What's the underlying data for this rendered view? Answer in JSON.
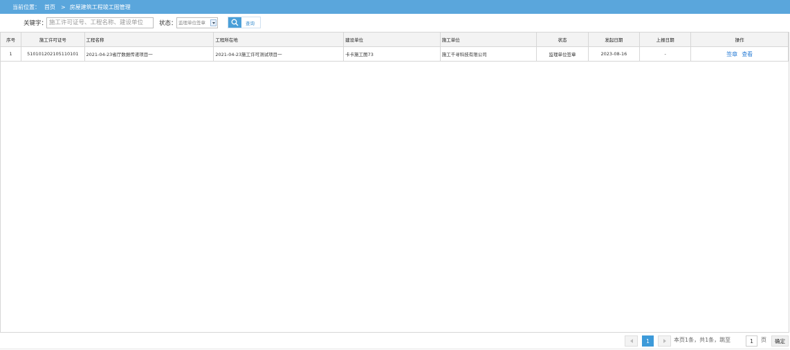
{
  "breadcrumb": {
    "prefix": "当前位置：",
    "home": "首页",
    "separator": ">",
    "current": "房屋建筑工程竣工图管理"
  },
  "filters": {
    "keyword_label": "关键字：",
    "keyword_placeholder": "施工许可证号、工程名称、建设单位",
    "status_label": "状态：",
    "status_value": "监理单位签章",
    "search_label": "查询"
  },
  "table": {
    "headers": [
      "序号",
      "施工许可证号",
      "工程名称",
      "工程所在地",
      "建设单位",
      "施工单位",
      "状态",
      "发起日期",
      "上报日期",
      "操作"
    ],
    "rows": [
      {
        "index": "1",
        "permit_no": "510101202105110101",
        "project_name": "2021-04-23省厅数据传递项目一",
        "location": "2021-04-23施工许可测试项目一",
        "owner": "卡卡施工图73",
        "contractor": "施工千寻科技有限公司",
        "status": "监理单位签章",
        "start_date": "2023-08-16",
        "report_date": "-",
        "actions": [
          "签章",
          "查看"
        ]
      }
    ]
  },
  "pagination": {
    "current_page": "1",
    "summary": "本页1条，共1条，跳至",
    "jump_value": "1",
    "page_unit": "页",
    "confirm_label": "确定"
  },
  "colors": {
    "header_bar": "#5aa6dc",
    "accent": "#3d9ad9",
    "link": "#2e7fd6"
  }
}
